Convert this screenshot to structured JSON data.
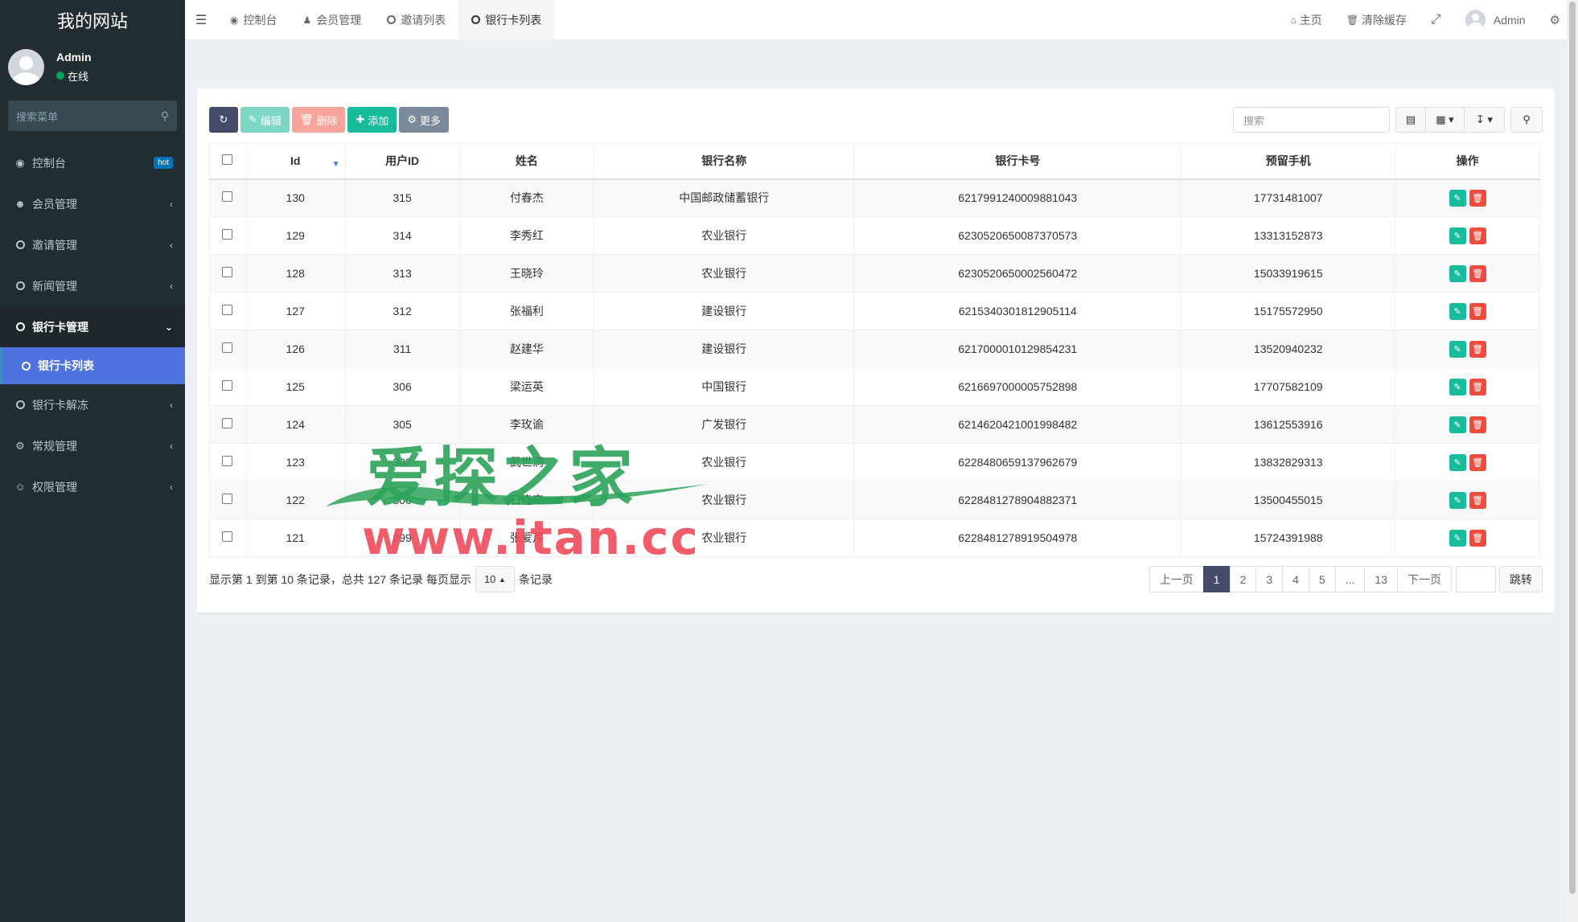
{
  "site": {
    "title": "我的网站"
  },
  "user": {
    "name": "Admin",
    "status": "在线"
  },
  "sidebar": {
    "search_placeholder": "搜索菜单",
    "items": [
      {
        "label": "控制台",
        "icon": "dashboard-icon",
        "badge": "hot"
      },
      {
        "label": "会员管理",
        "icon": "user-circle-icon"
      },
      {
        "label": "邀请管理",
        "icon": "circle-icon"
      },
      {
        "label": "新闻管理",
        "icon": "circle-icon"
      },
      {
        "label": "银行卡管理",
        "icon": "circle-icon"
      },
      {
        "label": "银行卡列表",
        "icon": "circle-icon"
      },
      {
        "label": "银行卡解冻",
        "icon": "circle-icon"
      },
      {
        "label": "常规管理",
        "icon": "cogs-icon"
      },
      {
        "label": "权限管理",
        "icon": "users-icon"
      }
    ]
  },
  "topbar": {
    "tabs": [
      {
        "label": "控制台"
      },
      {
        "label": "会员管理"
      },
      {
        "label": "邀请列表"
      },
      {
        "label": "银行卡列表"
      }
    ],
    "home": "主页",
    "clear_cache": "清除缓存",
    "user": "Admin"
  },
  "toolbar": {
    "edit": "编辑",
    "delete": "删除",
    "add": "添加",
    "more": "更多",
    "search_placeholder": "搜索"
  },
  "table": {
    "headers": [
      "Id",
      "用户ID",
      "姓名",
      "银行名称",
      "银行卡号",
      "预留手机",
      "操作"
    ],
    "rows": [
      [
        "130",
        "315",
        "付春杰",
        "中国邮政储蓄银行",
        "6217991240009881043",
        "17731481007"
      ],
      [
        "129",
        "314",
        "李秀红",
        "农业银行",
        "6230520650087370573",
        "13313152873"
      ],
      [
        "128",
        "313",
        "王晓玲",
        "农业银行",
        "6230520650002560472",
        "15033919615"
      ],
      [
        "127",
        "312",
        "张福利",
        "建设银行",
        "6215340301812905114",
        "15175572950"
      ],
      [
        "126",
        "311",
        "赵建华",
        "建设银行",
        "6217000010129854231",
        "13520940232"
      ],
      [
        "125",
        "306",
        "梁运英",
        "中国银行",
        "6216697000005752898",
        "17707582109"
      ],
      [
        "124",
        "305",
        "李玫谕",
        "广发银行",
        "6214620421001998482",
        "13612553916"
      ],
      [
        "123",
        "302",
        "武世洞",
        "农业银行",
        "6228480659137962679",
        "13832829313"
      ],
      [
        "122",
        "300",
        "石连宝",
        "农业银行",
        "6228481278904882371",
        "13500455015"
      ],
      [
        "121",
        "299",
        "张爱芹",
        "农业银行",
        "6228481278919504978",
        "15724391988"
      ]
    ]
  },
  "pager": {
    "info": "显示第 1 到第 10 条记录，总共 127 条记录 每页显示",
    "page_size": "10",
    "suffix": "条记录",
    "prev": "上一页",
    "pages": [
      "1",
      "2",
      "3",
      "4",
      "5",
      "...",
      "13"
    ],
    "next": "下一页",
    "jump": "跳转"
  },
  "watermark": {
    "cn": "爱探之家",
    "en": "www.itan.cc"
  }
}
